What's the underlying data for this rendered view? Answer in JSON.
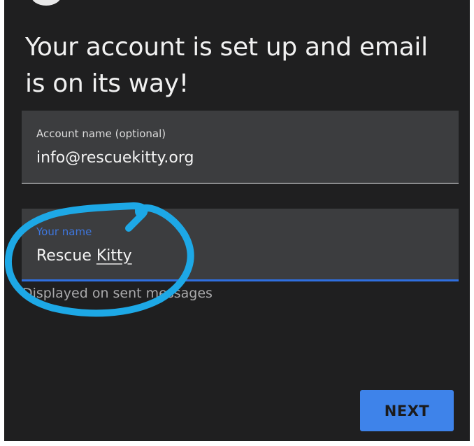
{
  "setup": {
    "title": "Your account is set up and email is on its way!",
    "account_field": {
      "label": "Account name (optional)",
      "value": "info@rescuekitty.org"
    },
    "name_field": {
      "label": "Your name",
      "value_first": "Rescue",
      "value_second": "Kitty",
      "helper": "Displayed on sent messages"
    },
    "next_label": "NEXT"
  },
  "colors": {
    "background": "#1f1f20",
    "field_background": "#3c3d3f",
    "focus_accent": "#2f6fe0",
    "button": "#3e83ea",
    "annotation": "#1da8e6"
  }
}
